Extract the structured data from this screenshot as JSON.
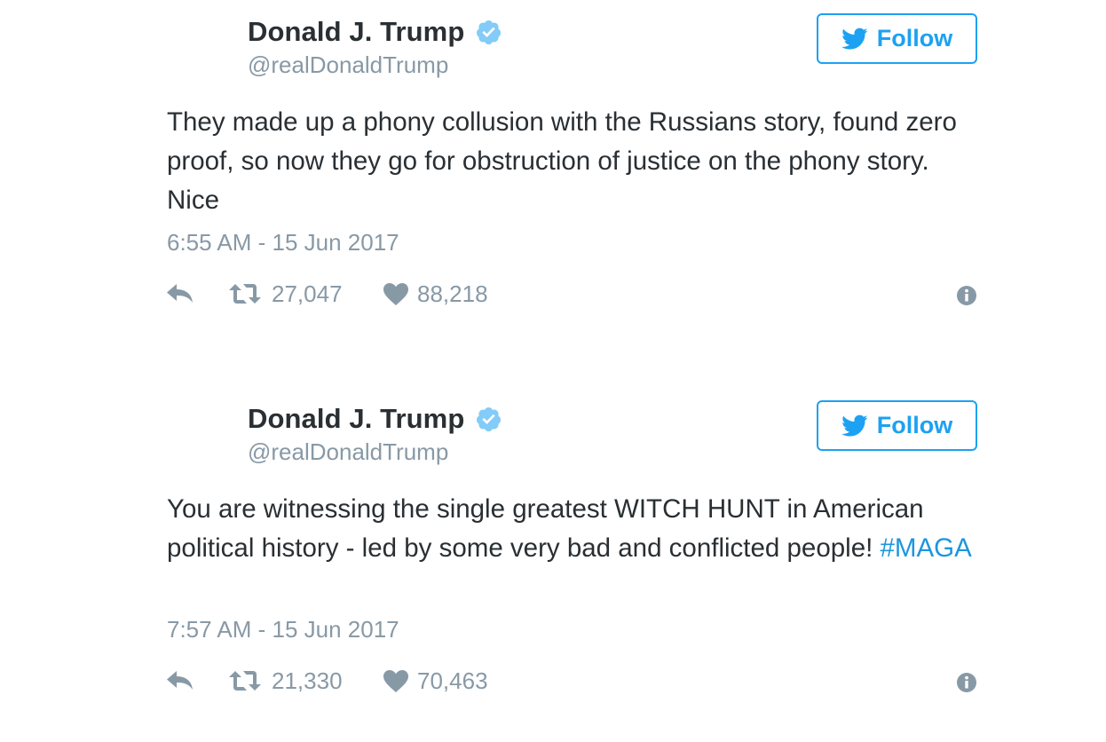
{
  "colors": {
    "accent": "#1da1f2",
    "link": "#1b95e0",
    "muted": "#8899a6",
    "text": "#292f33"
  },
  "tweets": [
    {
      "author": {
        "name": "Donald J. Trump",
        "handle": "@realDonaldTrump",
        "verified": true
      },
      "follow_label": "Follow",
      "text": "They made up a phony collusion with the Russians story, found zero proof, so now they go for obstruction of justice on the phony story. Nice",
      "hashtag": "",
      "timestamp": "6:55 AM - 15 Jun 2017",
      "retweets": "27,047",
      "likes": "88,218",
      "icons": [
        "reply-icon",
        "retweet-icon",
        "heart-icon",
        "info-icon",
        "verified-badge-icon",
        "twitter-bird-icon"
      ]
    },
    {
      "author": {
        "name": "Donald J. Trump",
        "handle": "@realDonaldTrump",
        "verified": true
      },
      "follow_label": "Follow",
      "text": "You are witnessing the single greatest WITCH HUNT in American political history - led by some very bad and conflicted people! ",
      "hashtag": "#MAGA",
      "timestamp": "7:57 AM - 15 Jun 2017",
      "retweets": "21,330",
      "likes": "70,463",
      "icons": [
        "reply-icon",
        "retweet-icon",
        "heart-icon",
        "info-icon",
        "verified-badge-icon",
        "twitter-bird-icon"
      ]
    }
  ]
}
